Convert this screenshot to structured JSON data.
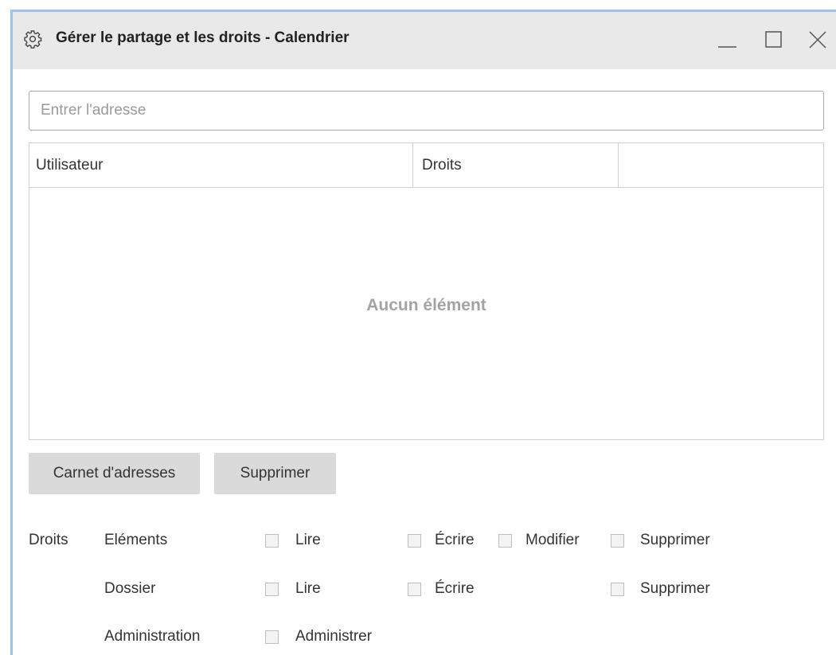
{
  "window": {
    "title": "Gérer le partage et les droits - Calendrier",
    "icon": "gear-icon",
    "controls": [
      "minimize-icon",
      "maximize-icon",
      "close-icon"
    ]
  },
  "address": {
    "placeholder": "Entrer l'adresse",
    "value": ""
  },
  "grid": {
    "columns": [
      "Utilisateur",
      "Droits",
      ""
    ],
    "rows": [],
    "empty_text": "Aucun élément"
  },
  "buttons": {
    "address_book": "Carnet d'adresses",
    "delete": "Supprimer"
  },
  "rights": {
    "label": "Droits",
    "items_row": {
      "label": "Eléments",
      "options": [
        {
          "label": "Lire",
          "checked": false
        },
        {
          "label": "Écrire",
          "checked": false
        },
        {
          "label": "Modifier",
          "checked": false
        },
        {
          "label": "Supprimer",
          "checked": false
        }
      ]
    },
    "folder_row": {
      "label": "Dossier",
      "options": [
        {
          "label": "Lire",
          "checked": false
        },
        {
          "label": "Écrire",
          "checked": false
        },
        {
          "label": "Supprimer",
          "checked": false
        }
      ]
    },
    "admin_row": {
      "label": "Administration",
      "options": [
        {
          "label": "Administrer",
          "checked": false
        }
      ]
    }
  }
}
